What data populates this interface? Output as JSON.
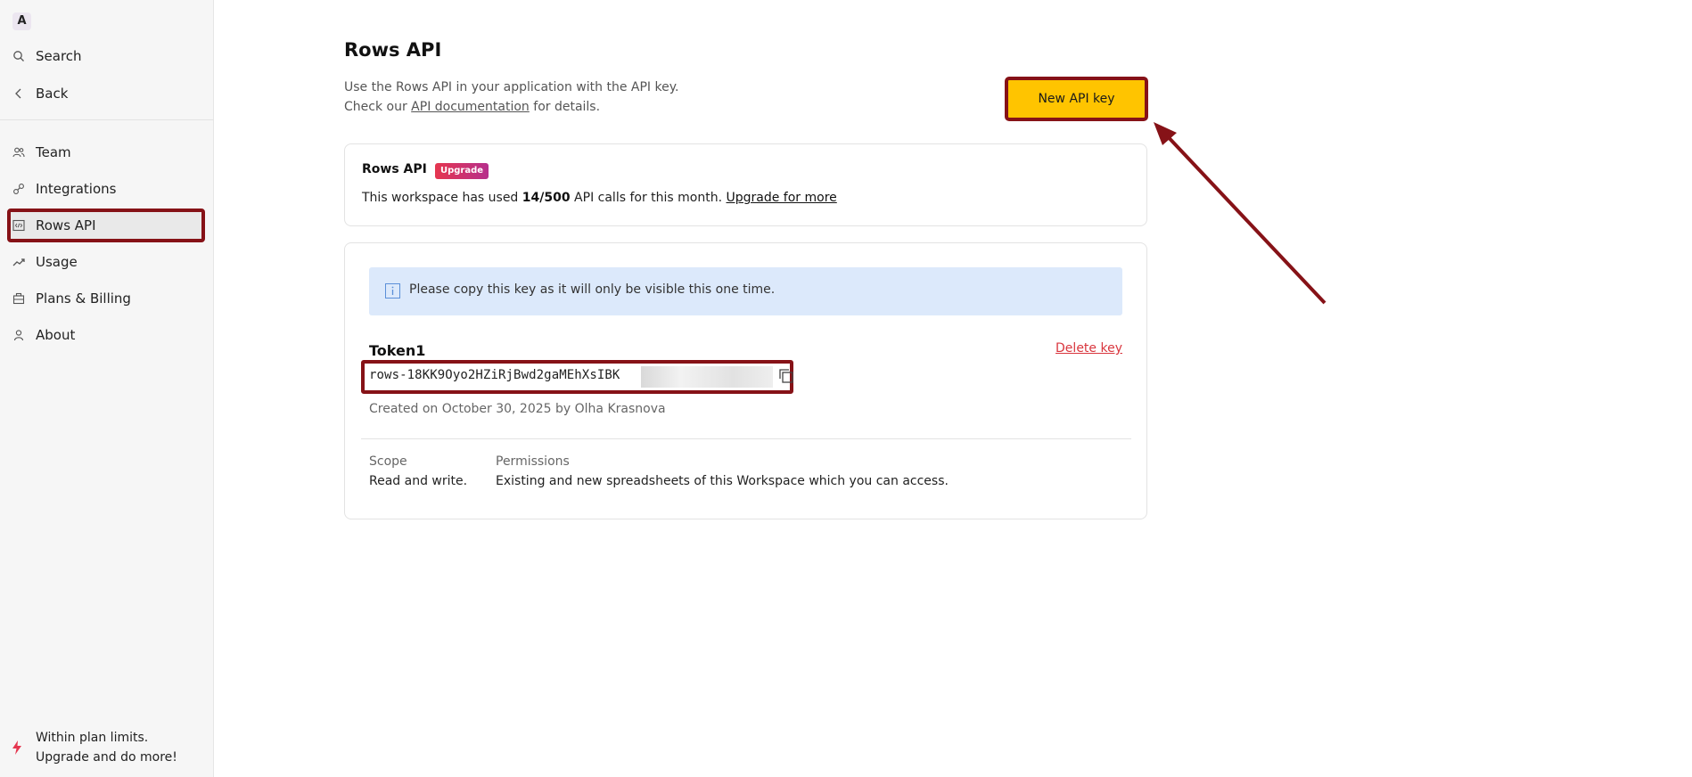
{
  "workspace": {
    "avatar_letter": "A"
  },
  "sidebar": {
    "top_items": [
      {
        "label": "Search",
        "icon": "search-icon"
      },
      {
        "label": "Back",
        "icon": "chevron-left-icon"
      }
    ],
    "items": [
      {
        "label": "Team",
        "icon": "team-icon"
      },
      {
        "label": "Integrations",
        "icon": "link-icon"
      },
      {
        "label": "Rows API",
        "icon": "code-icon",
        "active": true
      },
      {
        "label": "Usage",
        "icon": "trend-icon"
      },
      {
        "label": "Plans & Billing",
        "icon": "briefcase-icon"
      },
      {
        "label": "About",
        "icon": "person-icon"
      }
    ],
    "plan_note": {
      "line1": "Within plan limits.",
      "line2": "Upgrade and do more!",
      "icon": "bolt-icon"
    }
  },
  "main": {
    "title": "Rows API",
    "intro_line1": "Use the Rows API in your application with the API key.",
    "intro_line2_prefix": "Check our ",
    "intro_link": "API documentation",
    "intro_line2_suffix": " for details.",
    "new_key_button": "New API key",
    "usage_card": {
      "title": "Rows API",
      "badge": "Upgrade",
      "text_prefix": "This workspace has used ",
      "count": "14/500",
      "text_suffix": " API calls for this month. ",
      "link": "Upgrade for more"
    },
    "key_card": {
      "info": "Please copy this key as it will only be visible this one time.",
      "token_name": "Token1",
      "delete_label": "Delete key",
      "token_value": "rows-18KK9Oyo2HZiRjBwd2gaMEhXsIBK",
      "created": "Created on October 30, 2025 by Olha Krasnova",
      "scope_label": "Scope",
      "scope_value": "Read and write.",
      "permissions_label": "Permissions",
      "permissions_value": "Existing and new spreadsheets of this Workspace which you can access."
    }
  },
  "colors": {
    "accent": "#ffc400",
    "highlight_border": "#861217",
    "danger": "#d9363e",
    "info_bg": "#dce9fb"
  }
}
